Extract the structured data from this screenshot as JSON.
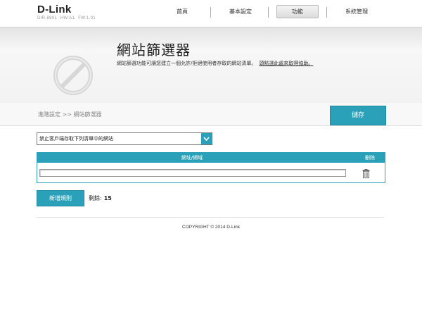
{
  "header": {
    "logo": "D-Link",
    "model": "DIR-880L",
    "hw": "HW:A1",
    "fw": "FW:1.01",
    "nav": [
      {
        "label": "首頁"
      },
      {
        "label": "基本設定"
      },
      {
        "label": "功能",
        "active": true
      },
      {
        "label": "系統管理"
      }
    ]
  },
  "banner": {
    "icon": "prohibited-globe-icon",
    "title": "網站篩選器",
    "description": "網站篩選功能可讓您建立一個允許/拒絕使用者存取的網站清單。",
    "link": "頭點選此處來取得協助。"
  },
  "breadcrumb": "進階設定 >> 網站篩選器",
  "toolbar": {
    "save_label": "儲存"
  },
  "filter": {
    "selected": "禁止客戶端存取下列清單中的網站"
  },
  "table": {
    "columns": [
      "網址/網域",
      "刪除"
    ],
    "rows": [
      {
        "url": "",
        "delete_icon": "trash-icon"
      }
    ]
  },
  "add_rule_label": "新增規則",
  "remaining": {
    "label": "剩餘:",
    "count": "15"
  },
  "footer": {
    "copyright": "COPYRIGHT © 2014 D-Link"
  },
  "colors": {
    "accent": "#2aa1b9",
    "banner_bg": "#f2f2f2"
  }
}
